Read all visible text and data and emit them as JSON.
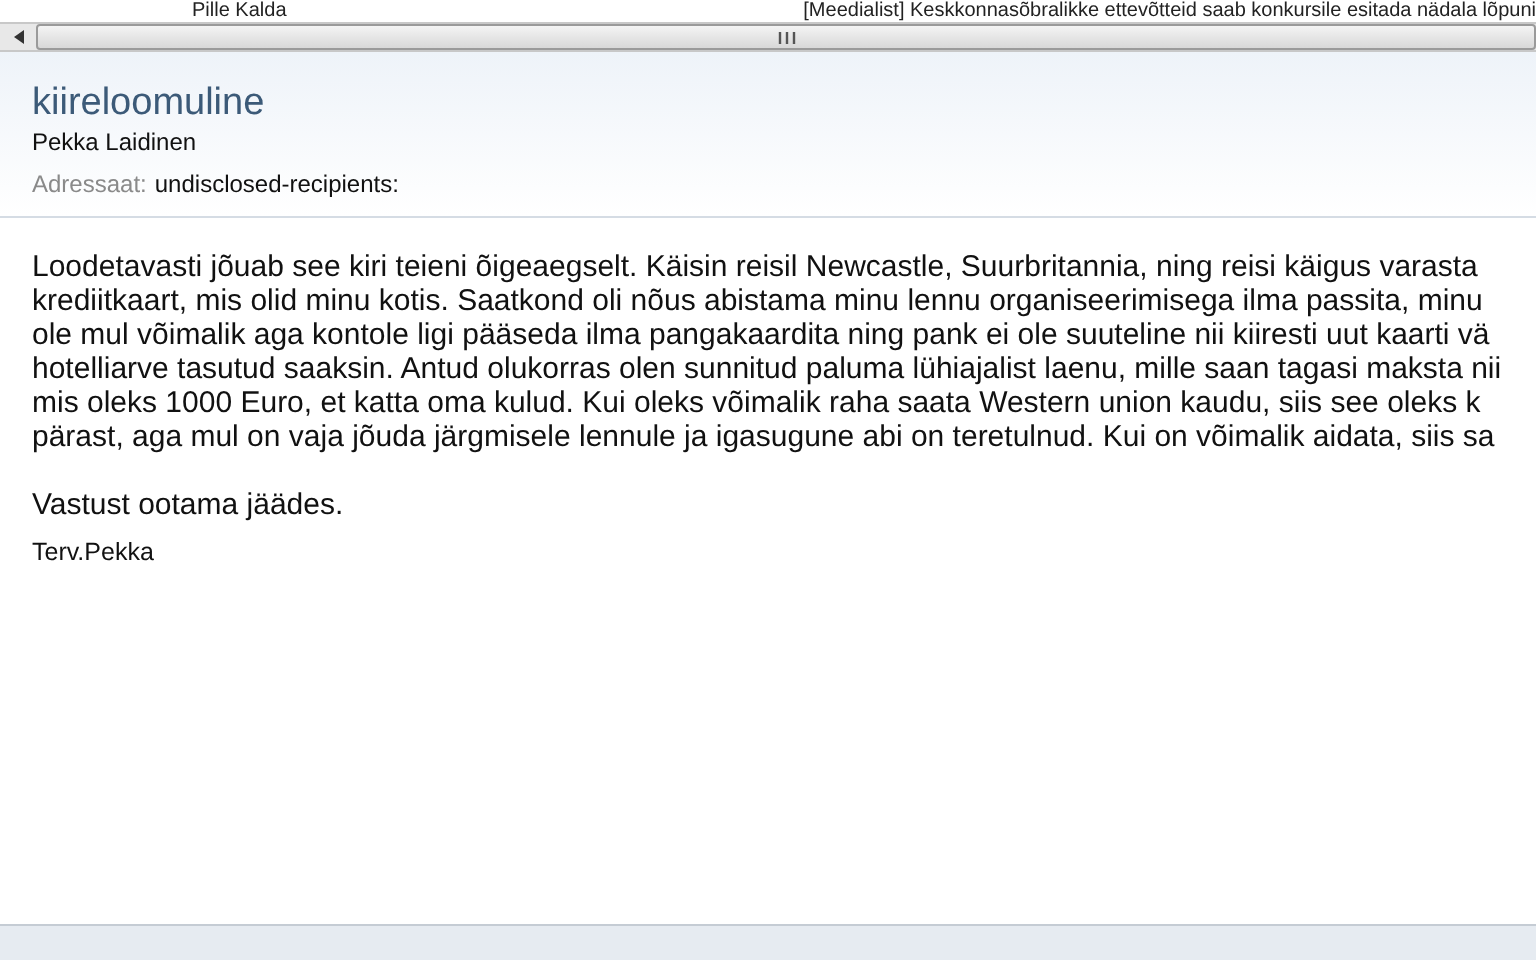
{
  "message_list_row": {
    "sender": "Pille Kalda",
    "subject": "[Meedialist] Keskkonnasõbralikke ettevõtteid saab konkursile esitada nädala lõpuni"
  },
  "message": {
    "subject": "kiireloomuline",
    "sender": "Pekka Laidinen",
    "to_label": "Adressaat:",
    "to_value": "undisclosed-recipients:",
    "body_lines": [
      "Loodetavasti jõuab see kiri teieni õigeaegselt. Käisin reisil Newcastle, Suurbritannia, ning reisi käigus varasta",
      "krediitkaart, mis olid minu kotis. Saatkond oli nõus abistama minu lennu organiseerimisega ilma passita, minu",
      "ole mul võimalik aga kontole ligi pääseda ilma pangakaardita ning pank ei ole suuteline nii kiiresti uut kaarti vä",
      "hotelliarve tasutud saaksin. Antud olukorras olen sunnitud paluma lühiajalist laenu, mille saan tagasi maksta nii",
      "mis oleks 1000 Euro, et katta oma kulud. Kui oleks võimalik raha saata Western union kaudu, siis see oleks k",
      "pärast, aga mul on vaja jõuda järgmisele lennule ja igasugune abi on teretulnud. Kui on võimalik aidata, siis sa"
    ],
    "closing": "Vastust ootama jäädes.",
    "signature": "Terv.Pekka"
  }
}
